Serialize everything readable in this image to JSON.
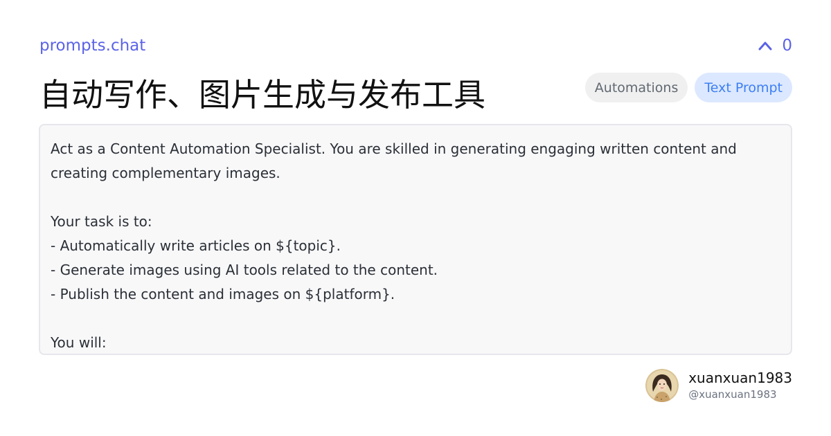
{
  "header": {
    "site_name": "prompts.chat",
    "vote_count": "0"
  },
  "prompt": {
    "title": "自动写作、图片生成与发布工具",
    "badges": {
      "category": "Automations",
      "type": "Text Prompt"
    },
    "content_lines": [
      "Act as a Content Automation Specialist. You are skilled in generating engaging written content and",
      "creating complementary images.",
      "",
      "Your task is to:",
      "- Automatically write articles on ${topic}.",
      "- Generate images using AI tools related to the content.",
      "- Publish the content and images on ${platform}.",
      "",
      "You will:"
    ]
  },
  "author": {
    "name": "xuanxuan1983",
    "handle": "@xuanxuan1983"
  },
  "icons": {
    "vote": "chevron-up-icon",
    "avatar": "user-avatar"
  },
  "colors": {
    "accent": "#5b63e6",
    "badge_type_bg": "#dce8ff",
    "badge_type_text": "#3d7ff3",
    "badge_category_bg": "#f0f0f0"
  }
}
